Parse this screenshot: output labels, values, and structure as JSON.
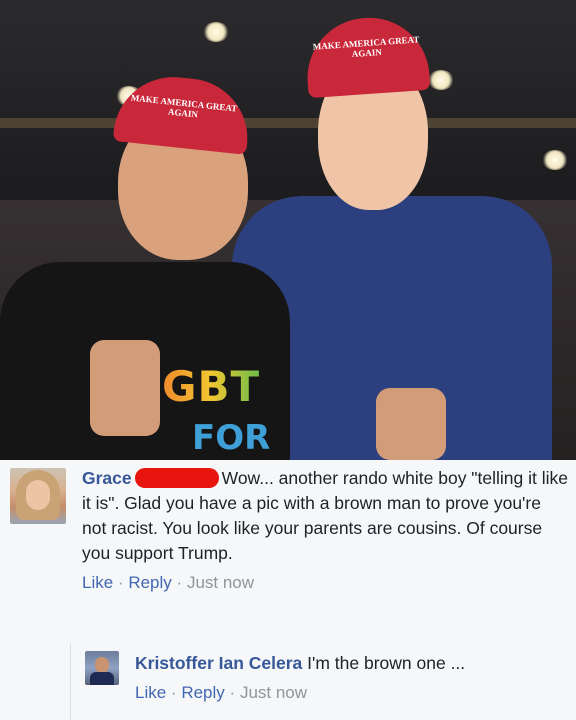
{
  "photo": {
    "left_cap_text": "MAKE AMERICA GREAT AGAIN",
    "right_cap_text": "MAKE AMERICA GREAT AGAIN",
    "shirt_text_1": "GBT",
    "shirt_text_2": "FOR"
  },
  "comment": {
    "author": "Grace",
    "text": "Wow... another rando white boy \"telling it like it is\". Glad you have a pic with a brown man to prove you're not racist. You look like your parents are cousins. Of course you support Trump.",
    "like_label": "Like",
    "reply_label": "Reply",
    "timestamp": "Just now",
    "separator": "·"
  },
  "reply": {
    "author": "Kristoffer Ian Celera",
    "text": "I'm the brown one ...",
    "like_label": "Like",
    "reply_label": "Reply",
    "timestamp": "Just now",
    "separator": "·"
  },
  "colors": {
    "link": "#4267b2",
    "author": "#365899",
    "redaction": "#e8140e",
    "meta": "#90949c"
  }
}
